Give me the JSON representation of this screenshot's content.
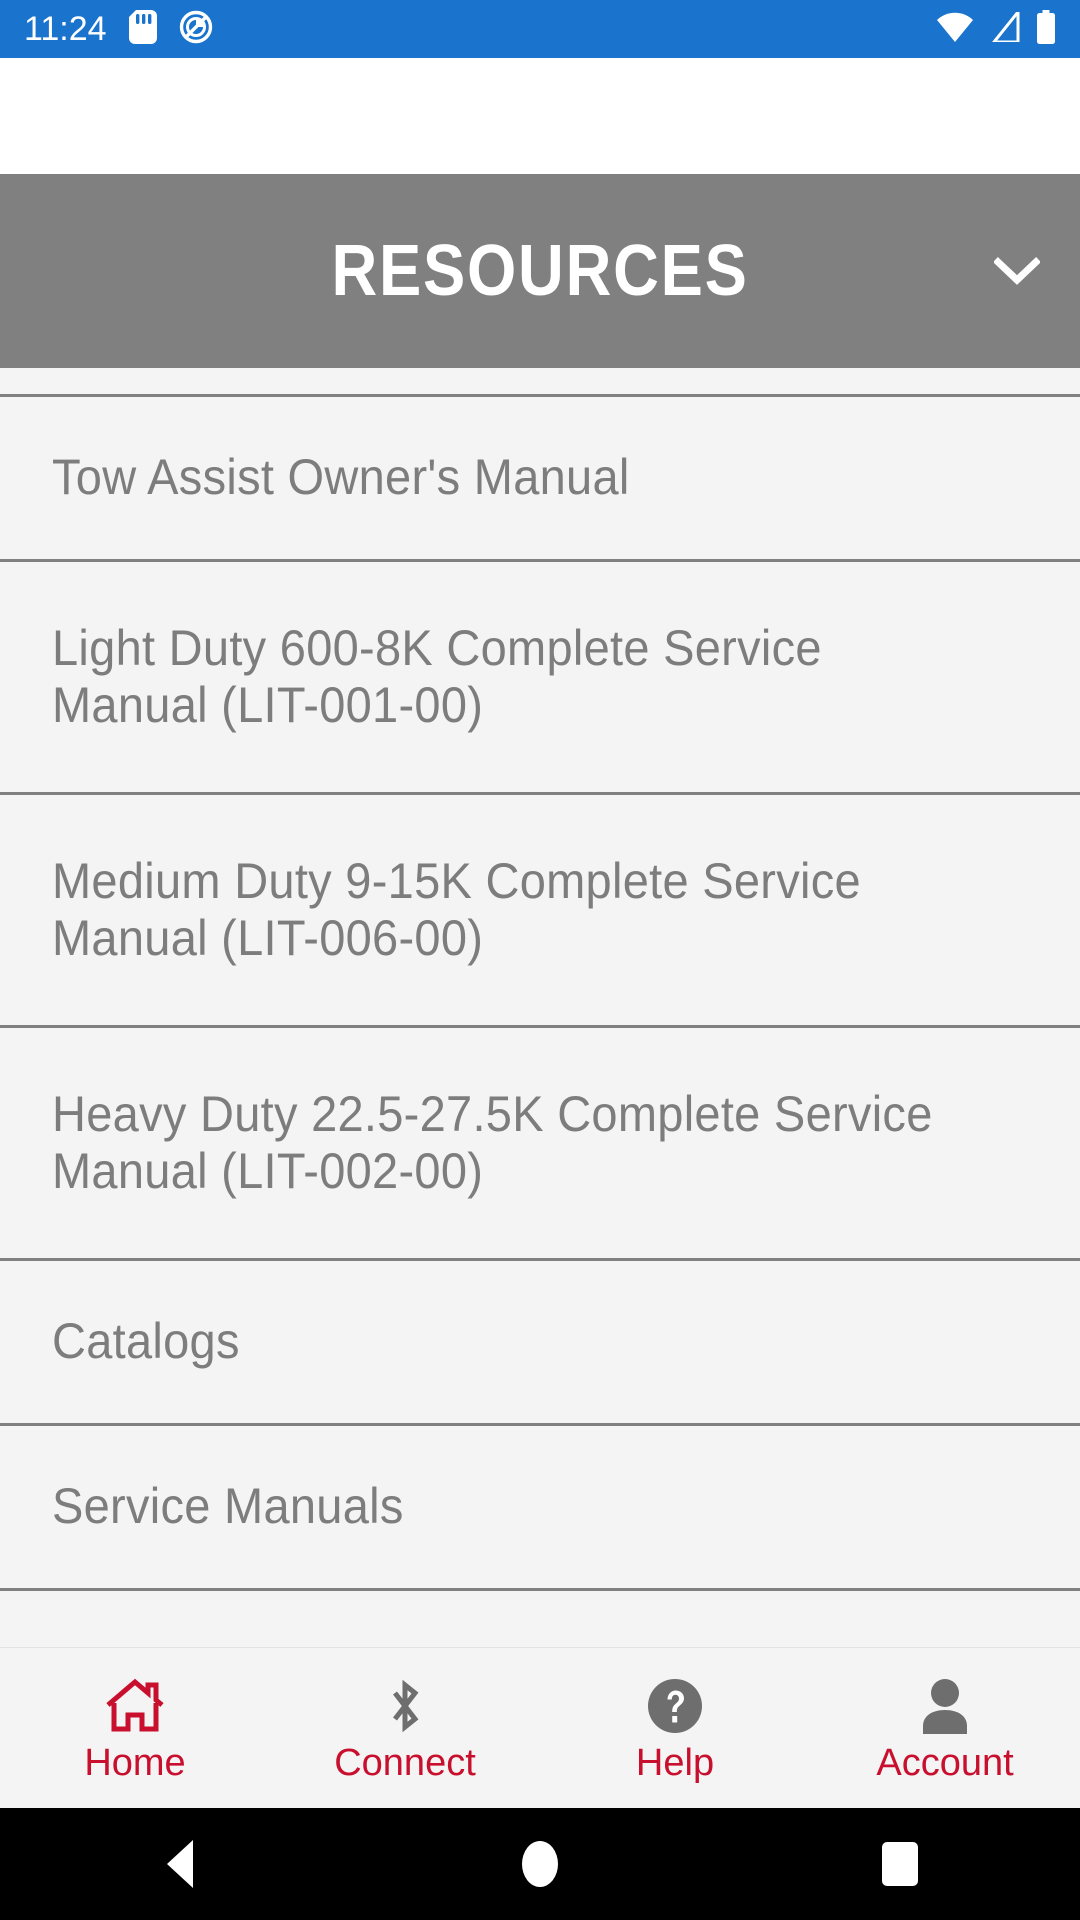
{
  "status_bar": {
    "time": "11:24",
    "left_icons": [
      "sd-card-icon",
      "do-not-disturb-icon"
    ],
    "right_icons": [
      "wifi-icon",
      "cell-signal-icon",
      "battery-icon"
    ],
    "background_color": "#1a73cc"
  },
  "section": {
    "title": "RESOURCES",
    "expander_icon": "chevron-down-icon",
    "background_color": "#808080",
    "text_color": "#ffffff"
  },
  "list": {
    "text_color": "#7d7d7d",
    "background_color": "#f4f4f4",
    "divider_color": "#808080",
    "items": [
      {
        "label": "Tow Assist Owner's Manual",
        "lines": 1
      },
      {
        "label": "Light Duty 600-8K Complete Service Manual (LIT-001-00)",
        "lines": 2
      },
      {
        "label": "Medium Duty 9-15K Complete Service Manual (LIT-006-00)",
        "lines": 2
      },
      {
        "label": "Heavy Duty 22.5-27.5K Complete Service Manual (LIT-002-00)",
        "lines": 2
      },
      {
        "label": "Catalogs",
        "lines": 1
      },
      {
        "label": "Service Manuals",
        "lines": 1
      }
    ]
  },
  "bottom_nav": {
    "label_color": "#c8102e",
    "active_icon_color": "#c8102e",
    "inactive_icon_color": "#6e6e6e",
    "items": [
      {
        "label": "Home",
        "icon": "home-icon",
        "active": true
      },
      {
        "label": "Connect",
        "icon": "bluetooth-icon",
        "active": false
      },
      {
        "label": "Help",
        "icon": "help-circle-icon",
        "active": false
      },
      {
        "label": "Account",
        "icon": "person-icon",
        "active": false
      }
    ]
  },
  "system_nav": {
    "background_color": "#000000",
    "buttons": [
      {
        "icon": "back-triangle-icon",
        "name": "back"
      },
      {
        "icon": "home-circle-icon",
        "name": "home"
      },
      {
        "icon": "recents-square-icon",
        "name": "recents"
      }
    ]
  }
}
